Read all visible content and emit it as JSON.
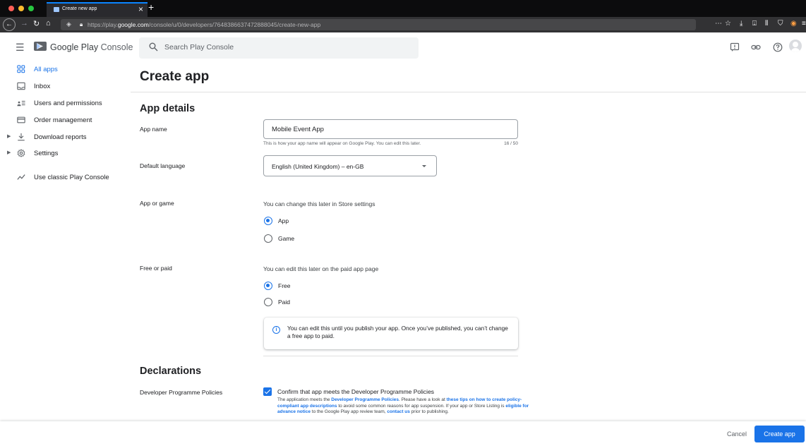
{
  "browser": {
    "tab_title": "Create new app",
    "url_prefix": "https://play.",
    "url_domain": "google.com",
    "url_path": "/console/u/0/developers/7648386637472888045/create-new-app",
    "accent": "#0a84ff"
  },
  "header": {
    "logo_brand": "Google Play",
    "logo_suffix": " Console",
    "search_placeholder": "Search Play Console"
  },
  "sidebar": {
    "items": [
      {
        "label": "All apps",
        "icon": "grid-icon",
        "active": true
      },
      {
        "label": "Inbox",
        "icon": "inbox-icon"
      },
      {
        "label": "Users and permissions",
        "icon": "people-icon"
      },
      {
        "label": "Order management",
        "icon": "credit-card-icon"
      },
      {
        "label": "Download reports",
        "icon": "download-icon",
        "expandable": true
      },
      {
        "label": "Settings",
        "icon": "gear-icon",
        "expandable": true
      },
      {
        "label": "Use classic Play Console",
        "icon": "trend-icon"
      }
    ]
  },
  "main": {
    "title": "Create app",
    "app_details": {
      "heading": "App details",
      "app_name": {
        "label": "App name",
        "value": "Mobile Event App",
        "helper": "This is how your app name will appear on Google Play. You can edit this later.",
        "counter": "16 / 50"
      },
      "default_language": {
        "label": "Default language",
        "value": "English (United Kingdom) – en-GB"
      },
      "app_or_game": {
        "label": "App or game",
        "hint": "You can change this later in Store settings",
        "options": [
          {
            "label": "App",
            "checked": true
          },
          {
            "label": "Game",
            "checked": false
          }
        ]
      },
      "free_or_paid": {
        "label": "Free or paid",
        "hint": "You can edit this later on the paid app page",
        "options": [
          {
            "label": "Free",
            "checked": true
          },
          {
            "label": "Paid",
            "checked": false
          }
        ],
        "info": "You can edit this until you publish your app. Once you’ve published, you can’t change a free app to paid."
      }
    },
    "declarations": {
      "heading": "Declarations",
      "policies": {
        "label": "Developer Programme Policies",
        "checkbox_label": "Confirm that app meets the Developer Programme Policies",
        "text_1": "The application meets the ",
        "link_1": "Developer Programme Policies",
        "text_2": ". Please have a look at ",
        "link_2": "these tips on how to create policy-compliant app descriptions",
        "text_3": " to avoid some common reasons for app suspension. If your app or Store Listing is ",
        "link_3": "eligible for advance notice",
        "text_4": " to the Google Play app review team, ",
        "link_4": "contact us",
        "text_5": " prior to publishing."
      }
    }
  },
  "footer": {
    "cancel_label": "Cancel",
    "create_label": "Create app"
  },
  "colors": {
    "primary": "#1a73e8",
    "text": "#202124",
    "muted": "#5f6368"
  }
}
